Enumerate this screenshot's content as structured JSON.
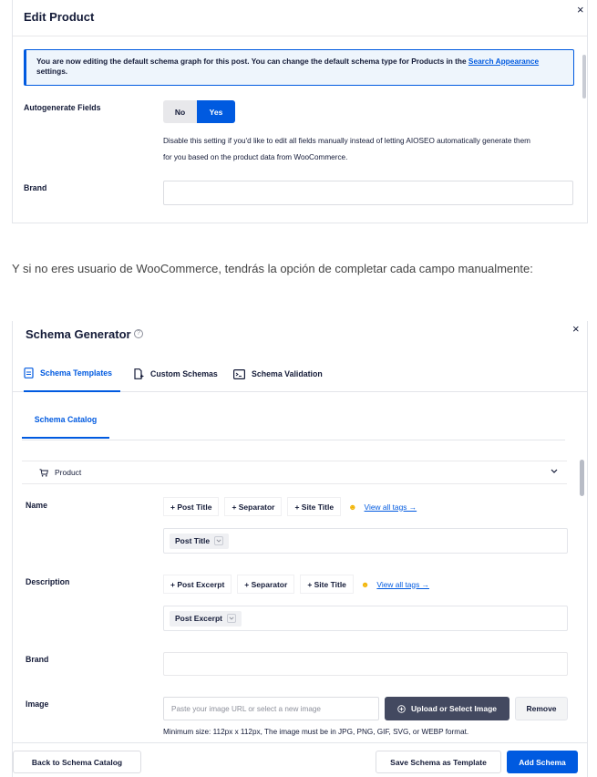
{
  "edit_product": {
    "title": "Edit Product",
    "close_glyph": "×",
    "notice_text": "You are now editing the default schema graph for this post. You can change the default schema type for Products in the ",
    "notice_link": "Search Appearance",
    "notice_suffix": " settings.",
    "autogenerate": {
      "label": "Autogenerate Fields",
      "no_label": "No",
      "yes_label": "Yes",
      "selected": "Yes",
      "help_line1": "Disable this setting if you'd like to edit all fields manually instead of letting AIOSEO automatically generate them",
      "help_line2": "for you based on the product data from WooCommerce."
    },
    "brand_label": "Brand",
    "brand_value": ""
  },
  "mid_text": "Y si no eres usuario de WooCommerce, tendrás la opción de completar cada campo manualmente:",
  "schema_generator": {
    "title": "Schema Generator",
    "help_glyph": "?",
    "close_glyph": "×",
    "tabs": [
      {
        "label": "Schema Templates",
        "icon": "document-icon",
        "active": true
      },
      {
        "label": "Custom Schemas",
        "icon": "new-document-icon",
        "active": false
      },
      {
        "label": "Schema Validation",
        "icon": "terminal-icon",
        "active": false
      }
    ],
    "subtab": "Schema Catalog",
    "product_select": "Product",
    "name": {
      "label": "Name",
      "tags": [
        "+ Post Title",
        "+ Separator",
        "+ Site Title"
      ],
      "emoji": "☻",
      "view_all": "View all tags →",
      "chip": "Post Title"
    },
    "description": {
      "label": "Description",
      "tags": [
        "+ Post Excerpt",
        "+ Separator",
        "+ Site Title"
      ],
      "emoji": "☻",
      "view_all": "View all tags →",
      "chip": "Post Excerpt"
    },
    "brand_label": "Brand",
    "image": {
      "label": "Image",
      "placeholder": "Paste your image URL or select a new image",
      "upload_label": "Upload or Select Image",
      "remove_label": "Remove",
      "help": "Minimum size: 112px x 112px, The image must be in JPG, PNG, GIF, SVG, or WEBP format."
    },
    "footer": {
      "back_label": "Back to Schema Catalog",
      "save_template_label": "Save Schema as Template",
      "add_label": "Add Schema"
    }
  },
  "colors": {
    "accent": "#005ae0",
    "text": "#141b38",
    "dark_button": "#434960"
  }
}
